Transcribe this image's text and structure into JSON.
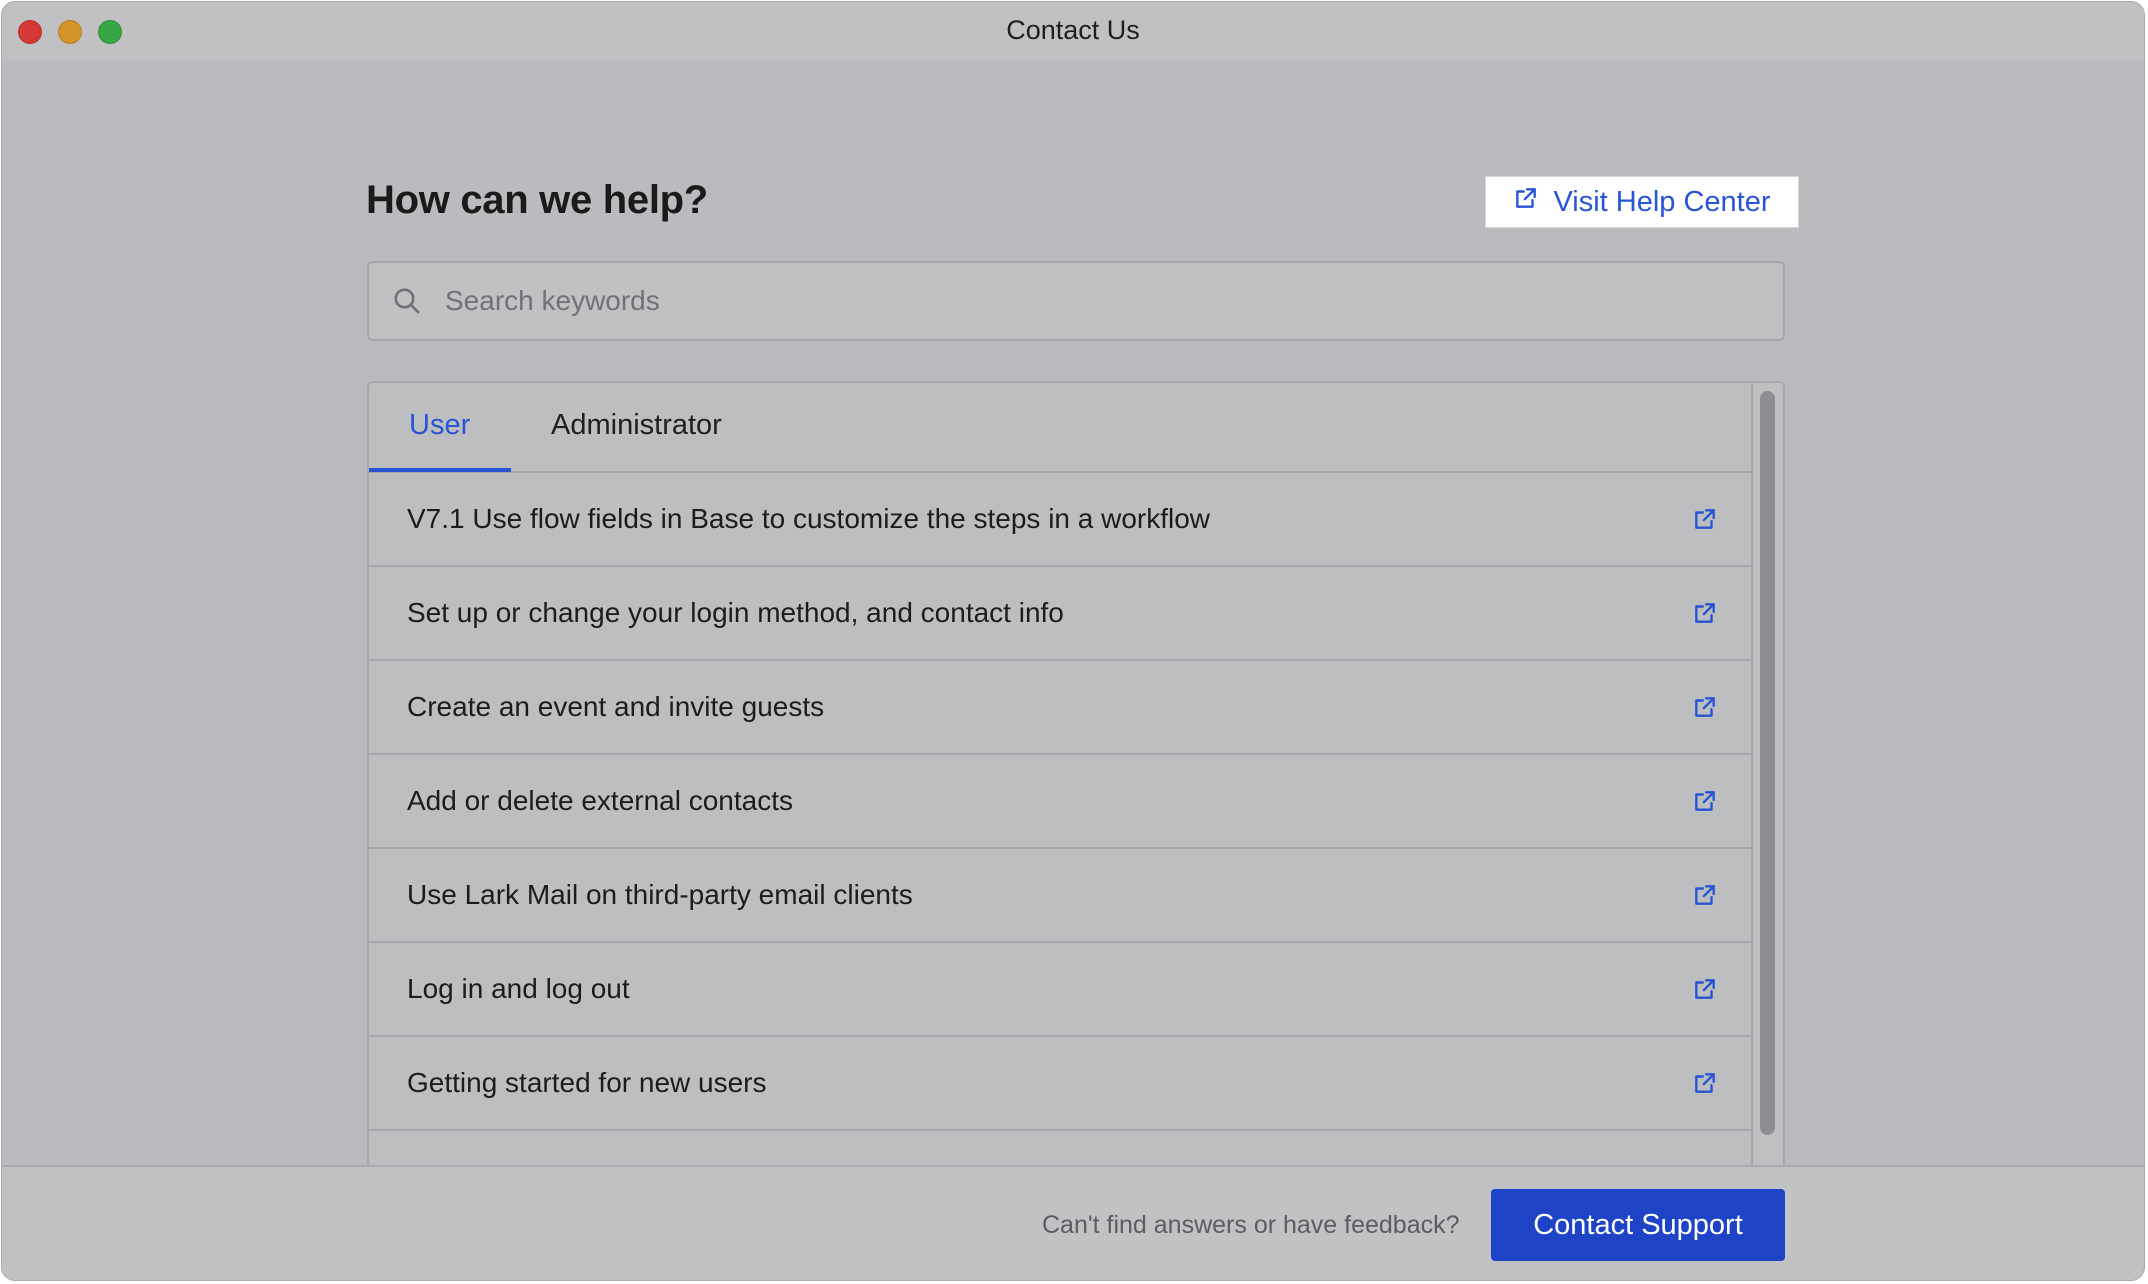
{
  "window": {
    "title": "Contact Us"
  },
  "header": {
    "title": "How can we help?",
    "help_center_label": "Visit Help Center"
  },
  "search": {
    "placeholder": "Search keywords",
    "value": ""
  },
  "tabs": [
    {
      "label": "User",
      "active": true
    },
    {
      "label": "Administrator",
      "active": false
    }
  ],
  "articles": [
    {
      "title": "V7.1 Use flow fields in Base to customize the steps in a workflow",
      "icon": "external-link-icon"
    },
    {
      "title": "Set up or change your login method, and contact info",
      "icon": "external-link-icon"
    },
    {
      "title": "Create an event and invite guests",
      "icon": "external-link-icon"
    },
    {
      "title": "Add or delete external contacts",
      "icon": "external-link-icon"
    },
    {
      "title": "Use Lark Mail on third-party email clients",
      "icon": "external-link-icon"
    },
    {
      "title": "Log in and log out",
      "icon": "external-link-icon"
    },
    {
      "title": "Getting started for new users",
      "icon": "external-link-icon"
    }
  ],
  "footer": {
    "prompt": "Can't find answers or have feedback?",
    "contact_label": "Contact Support"
  },
  "colors": {
    "accent": "#2855d6",
    "primary_button": "#1f43c7",
    "window_background": "#babbbe"
  }
}
